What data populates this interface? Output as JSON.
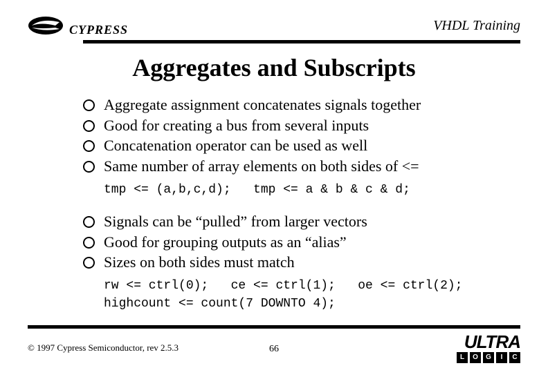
{
  "header": {
    "brand": "CYPRESS",
    "course": "VHDL Training"
  },
  "title": "Aggregates and Subscripts",
  "group1": {
    "b0": "Aggregate assignment concatenates signals together",
    "b1": "Good for creating a bus from several inputs",
    "b2": "Concatenation operator can be used as well",
    "b3": "Same number of array elements on both sides of <=",
    "code": "tmp <= (a,b,c,d);   tmp <= a & b & c & d;"
  },
  "group2": {
    "b0": "Signals can be “pulled” from larger vectors",
    "b1": "Good for grouping outputs as an “alias”",
    "b2": "Sizes on both sides must match",
    "code": "rw <= ctrl(0);   ce <= ctrl(1);   oe <= ctrl(2);\nhighcount <= count(7 DOWNTO 4);"
  },
  "footer": {
    "copyright": "© 1997 Cypress Semiconductor, rev 2.5.3",
    "page": "66",
    "ultra": "ULTRA",
    "ultra_sub": {
      "l": "L",
      "o": "O",
      "g": "G",
      "i": "I",
      "c": "C"
    }
  }
}
